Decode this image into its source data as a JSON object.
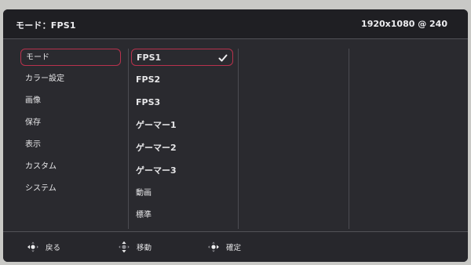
{
  "header": {
    "title": "モード：FPS1",
    "resolution": "1920x1080 @ 240"
  },
  "main_menu": {
    "items": [
      {
        "label": "モード",
        "selected": true
      },
      {
        "label": "カラー設定"
      },
      {
        "label": "画像"
      },
      {
        "label": "保存"
      },
      {
        "label": "表示"
      },
      {
        "label": "カスタム"
      },
      {
        "label": "システム"
      }
    ]
  },
  "sub_menu": {
    "items": [
      {
        "label": "FPS1",
        "selected": true,
        "checked": true
      },
      {
        "label": "FPS2"
      },
      {
        "label": "FPS3"
      },
      {
        "label": "ゲーマー1"
      },
      {
        "label": "ゲーマー2"
      },
      {
        "label": "ゲーマー3"
      },
      {
        "label": "動画"
      },
      {
        "label": "標準"
      }
    ]
  },
  "footer": {
    "back_label": "戻る",
    "move_label": "移動",
    "confirm_label": "確定"
  },
  "colors": {
    "accent": "#b8324d",
    "panel": "#2a2a2f"
  }
}
